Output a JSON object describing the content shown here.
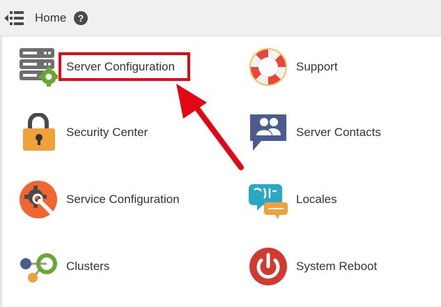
{
  "header": {
    "title": "Home",
    "help_symbol": "?",
    "menu_icon": "menu-collapse-icon",
    "help_icon": "help-circle-icon"
  },
  "tiles": [
    {
      "label": "Server Configuration",
      "icon": "server-gear-icon"
    },
    {
      "label": "Support",
      "icon": "lifebuoy-icon"
    },
    {
      "label": "Security Center",
      "icon": "padlock-icon"
    },
    {
      "label": "Server Contacts",
      "icon": "contacts-icon"
    },
    {
      "label": "Service Configuration",
      "icon": "wrench-gear-icon"
    },
    {
      "label": "Locales",
      "icon": "locales-speech-icon"
    },
    {
      "label": "Clusters",
      "icon": "clusters-icon"
    },
    {
      "label": "System Reboot",
      "icon": "power-icon"
    }
  ],
  "colors": {
    "annotation_red": "#e30613",
    "header_bg": "#f0f0f0",
    "text": "#333333"
  }
}
